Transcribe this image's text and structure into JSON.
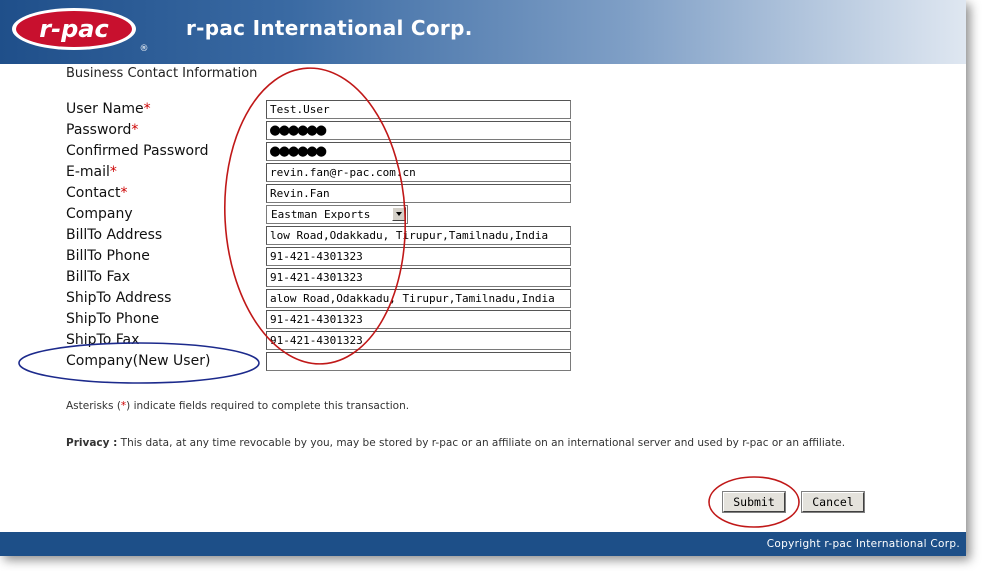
{
  "header": {
    "logo_text": "r-pac",
    "registered_mark": "®",
    "company_name": "r-pac International Corp."
  },
  "form": {
    "section_title": "Business Contact Information",
    "required_marker": "*",
    "fields": {
      "user_name": {
        "label": "User Name",
        "value": "Test.User"
      },
      "password": {
        "label": "Password",
        "value": "●●●●●●"
      },
      "confirm_password": {
        "label": "Confirmed Password",
        "value": "●●●●●●"
      },
      "email": {
        "label": "E-mail",
        "value": "revin.fan@r-pac.com.cn"
      },
      "contact": {
        "label": "Contact",
        "value": "Revin.Fan"
      },
      "company": {
        "label": "Company",
        "value": "Eastman Exports"
      },
      "billto_address": {
        "label": "BillTo Address",
        "value": "low Road,Odakkadu,  Tirupur,Tamilnadu,India"
      },
      "billto_phone": {
        "label": "BillTo Phone",
        "value": "91-421-4301323"
      },
      "billto_fax": {
        "label": "BillTo Fax",
        "value": "91-421-4301323"
      },
      "shipto_address": {
        "label": "ShipTo Address",
        "value": "alow Road,Odakkadu,  Tirupur,Tamilnadu,India"
      },
      "shipto_phone": {
        "label": "ShipTo Phone",
        "value": "91-421-4301323"
      },
      "shipto_fax": {
        "label": "ShipTo Fax",
        "value": "91-421-4301323"
      },
      "company_new_user": {
        "label": "Company(New User)",
        "value": ""
      }
    }
  },
  "notes": {
    "asterisk_prefix": "Asterisks (",
    "asterisk_suffix": ") indicate fields required to complete this transaction.",
    "privacy_label": "Privacy :",
    "privacy_text": " This data, at any time revocable by you, may be stored by r-pac or an affiliate on an international server and used by r-pac or an affiliate."
  },
  "buttons": {
    "submit": "Submit",
    "cancel": "Cancel"
  },
  "footer": {
    "copyright": "Copyright r-pac International Corp."
  },
  "colors": {
    "header_blue": "#1f4f8a",
    "footer_blue": "#1d4f88",
    "required_red": "#cc0000",
    "annotation_red": "#c01818",
    "annotation_blue": "#1c2a8c"
  }
}
